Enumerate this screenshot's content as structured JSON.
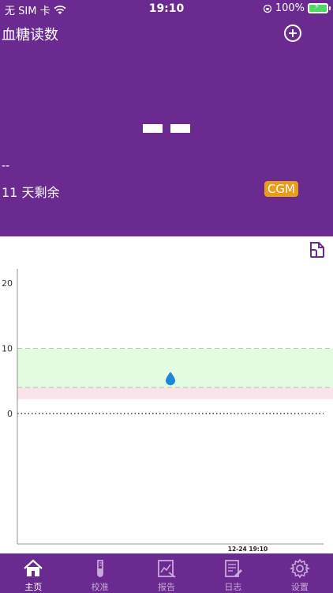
{
  "status_bar": {
    "carrier": "无 SIM 卡",
    "time": "19:10",
    "battery": "100%"
  },
  "header": {
    "title": "血糖读数",
    "reading": "--",
    "trend": "--",
    "days_remaining": "11 天剩余",
    "sensor_badge": "CGM"
  },
  "chart_data": {
    "type": "line",
    "y_ticks": [
      "0",
      "10",
      "20"
    ],
    "ylim": [
      0,
      22
    ],
    "x_ticks": [
      "12-24 19:10"
    ],
    "target_range": [
      4,
      10
    ],
    "low_band": [
      2.2,
      4
    ],
    "points": [
      {
        "x": "12-24 19:10",
        "y": 5.3
      }
    ],
    "series": [],
    "grid": false
  },
  "tabs": [
    {
      "label": "主页",
      "icon": "home-icon",
      "active": true
    },
    {
      "label": "校准",
      "icon": "calibrate-icon",
      "active": false
    },
    {
      "label": "报告",
      "icon": "report-icon",
      "active": false
    },
    {
      "label": "日志",
      "icon": "log-icon",
      "active": false
    },
    {
      "label": "设置",
      "icon": "settings-icon",
      "active": false
    }
  ],
  "colors": {
    "brand": "#6a2a8f",
    "badge": "#e89d1a",
    "target_band": "#e3fbe1",
    "low_band": "#fbe3ea",
    "drop": "#1e88d8"
  }
}
